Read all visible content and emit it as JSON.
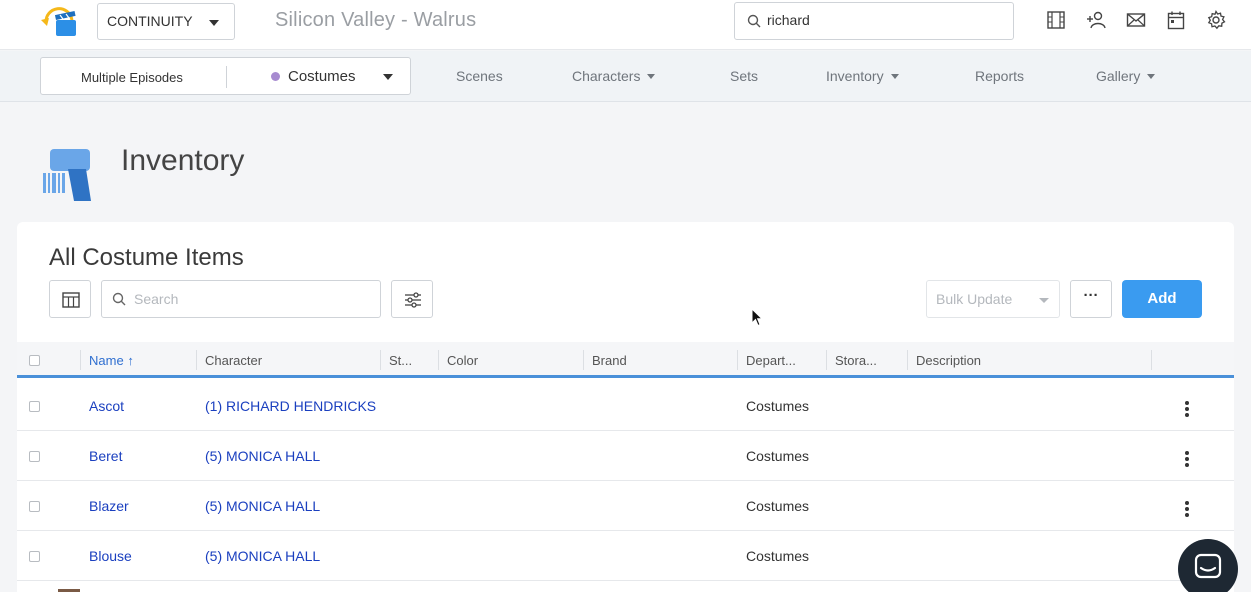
{
  "header": {
    "project_select": "CONTINUITY",
    "show_title": "Silicon Valley - Walrus",
    "search_value": "richard",
    "icons": [
      "film-icon",
      "add-person-icon",
      "mail-icon",
      "calendar-icon",
      "settings-icon"
    ]
  },
  "nav": {
    "episodes": "Multiple Episodes",
    "department": "Costumes",
    "items": [
      {
        "label": "Scenes",
        "dropdown": false
      },
      {
        "label": "Characters",
        "dropdown": true
      },
      {
        "label": "Sets",
        "dropdown": false
      },
      {
        "label": "Inventory",
        "dropdown": true
      },
      {
        "label": "Reports",
        "dropdown": false
      },
      {
        "label": "Gallery",
        "dropdown": true
      }
    ]
  },
  "page": {
    "title": "Inventory"
  },
  "card": {
    "title": "All Costume Items",
    "search_placeholder": "Search",
    "bulk_update": "Bulk Update",
    "more": "···",
    "add": "Add"
  },
  "table": {
    "columns": [
      "Name",
      "Character",
      "St...",
      "Color",
      "Brand",
      "Depart...",
      "Stora...",
      "Description"
    ],
    "sort_indicator": "↑",
    "rows": [
      {
        "name": "Ascot",
        "character": "(1) RICHARD HENDRICKS",
        "department": "Costumes"
      },
      {
        "name": "Beret",
        "character": "(5) MONICA HALL",
        "department": "Costumes"
      },
      {
        "name": "Blazer",
        "character": "(5) MONICA HALL",
        "department": "Costumes"
      },
      {
        "name": "Blouse",
        "character": "(5) MONICA HALL",
        "department": "Costumes"
      }
    ]
  },
  "colors": {
    "accent": "#3a9bf0",
    "link": "#1a3fbf",
    "department_dot": "#a78bd0"
  }
}
